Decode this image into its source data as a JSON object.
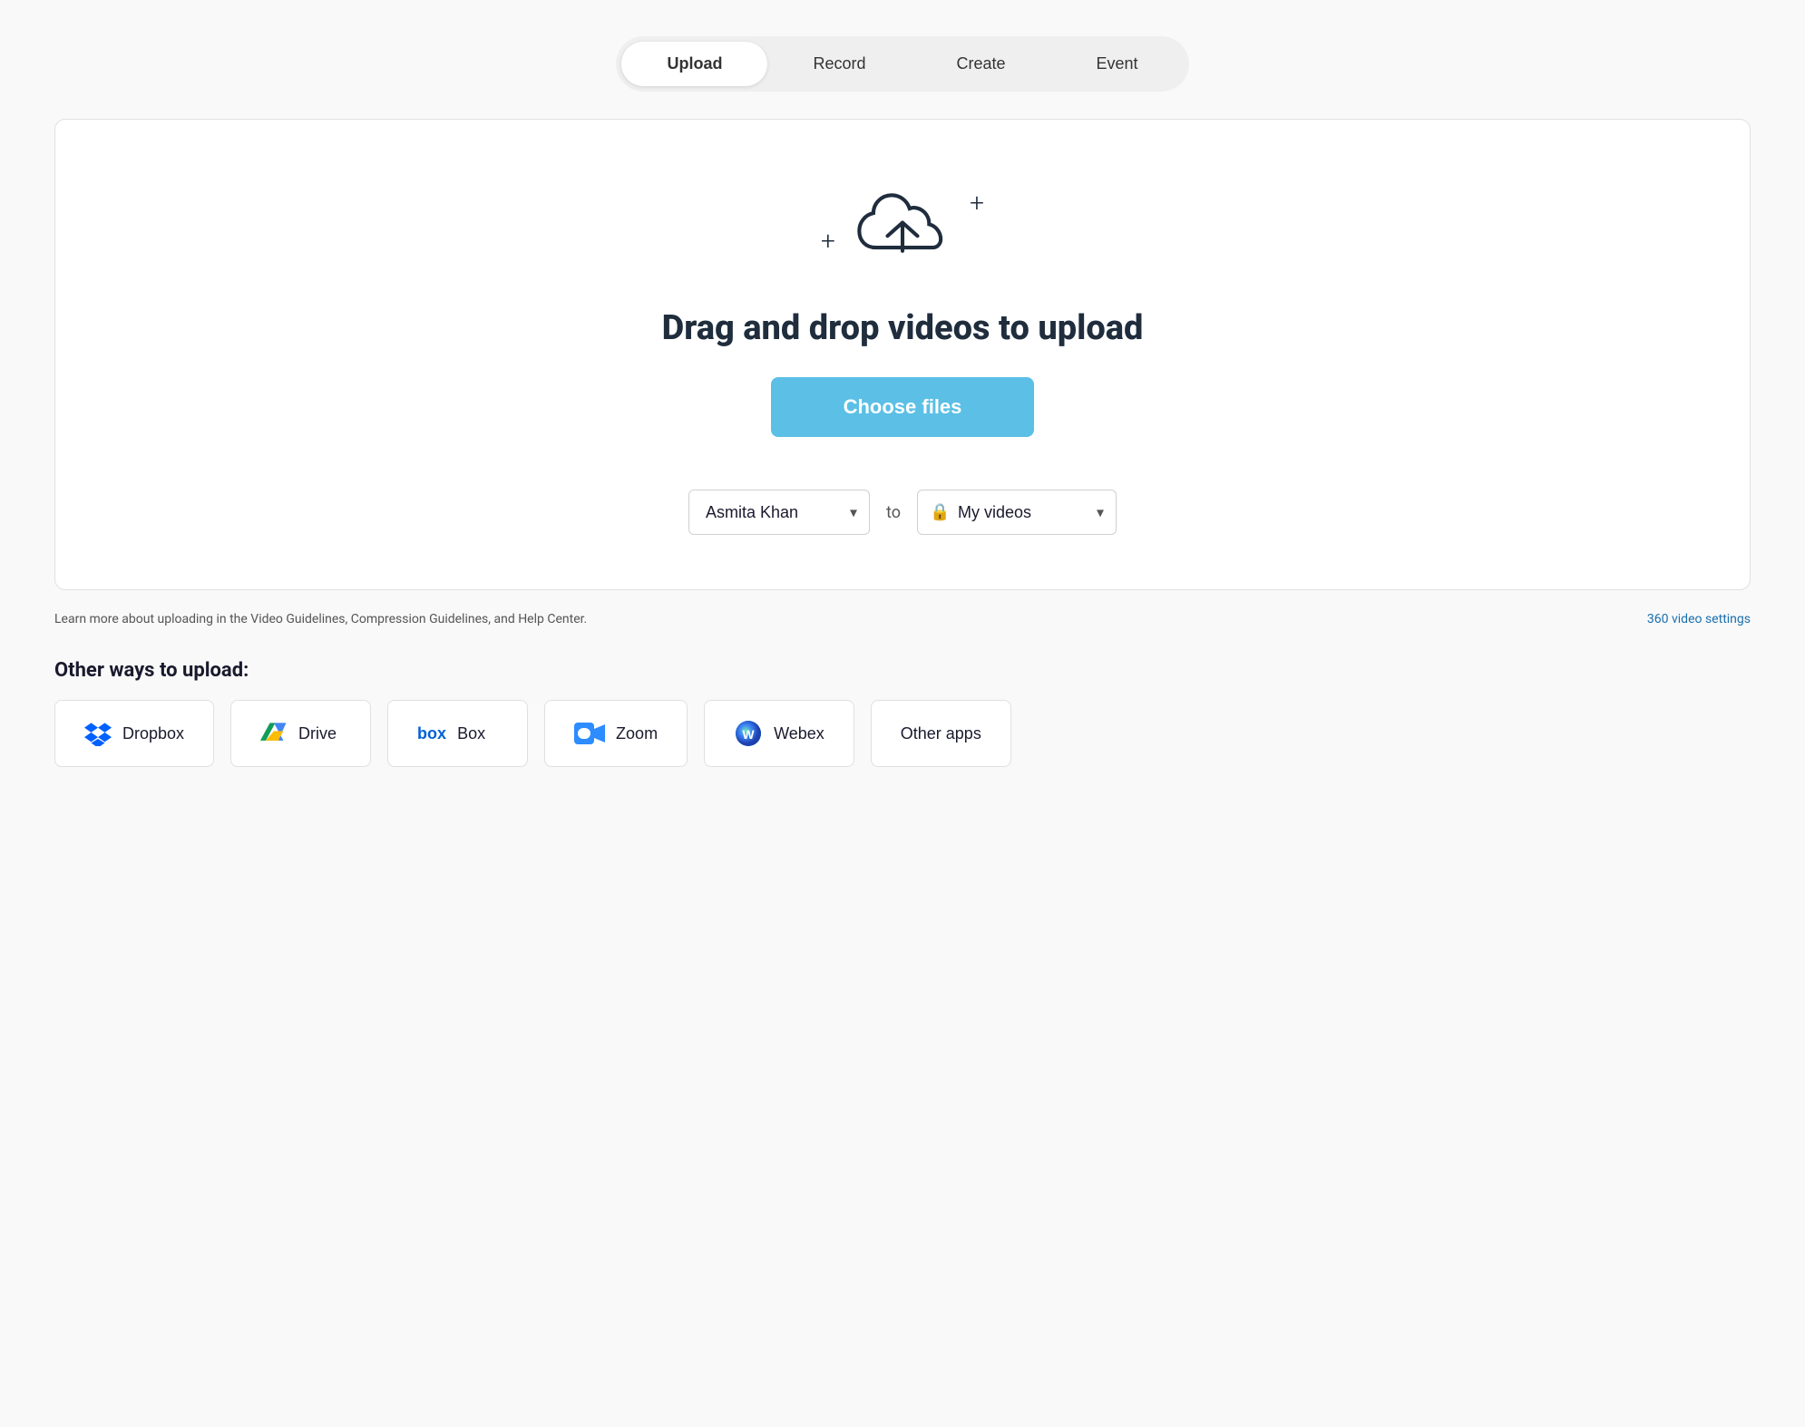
{
  "tabs": [
    {
      "id": "upload",
      "label": "Upload",
      "active": true
    },
    {
      "id": "record",
      "label": "Record",
      "active": false
    },
    {
      "id": "create",
      "label": "Create",
      "active": false
    },
    {
      "id": "event",
      "label": "Event",
      "active": false
    }
  ],
  "upload_area": {
    "drag_drop_text": "Drag and drop videos to upload",
    "choose_files_label": "Choose files",
    "to_label": "to",
    "uploader_name": "Asmita Khan",
    "destination_label": "My videos"
  },
  "info_bar": {
    "learn_more_text": "Learn more about uploading in the Video Guidelines, Compression Guidelines, and Help Center.",
    "settings_link": "360 video settings"
  },
  "other_ways": {
    "title": "Other ways to upload:",
    "items": [
      {
        "id": "dropbox",
        "label": "Dropbox"
      },
      {
        "id": "drive",
        "label": "Drive"
      },
      {
        "id": "box",
        "label": "Box"
      },
      {
        "id": "zoom",
        "label": "Zoom"
      },
      {
        "id": "webex",
        "label": "Webex"
      },
      {
        "id": "other-apps",
        "label": "Other apps"
      }
    ]
  },
  "icons": {
    "plus": "+",
    "cloud_upload": "cloud-upload-icon",
    "chevron_down": "▾",
    "lock": "🔒"
  }
}
